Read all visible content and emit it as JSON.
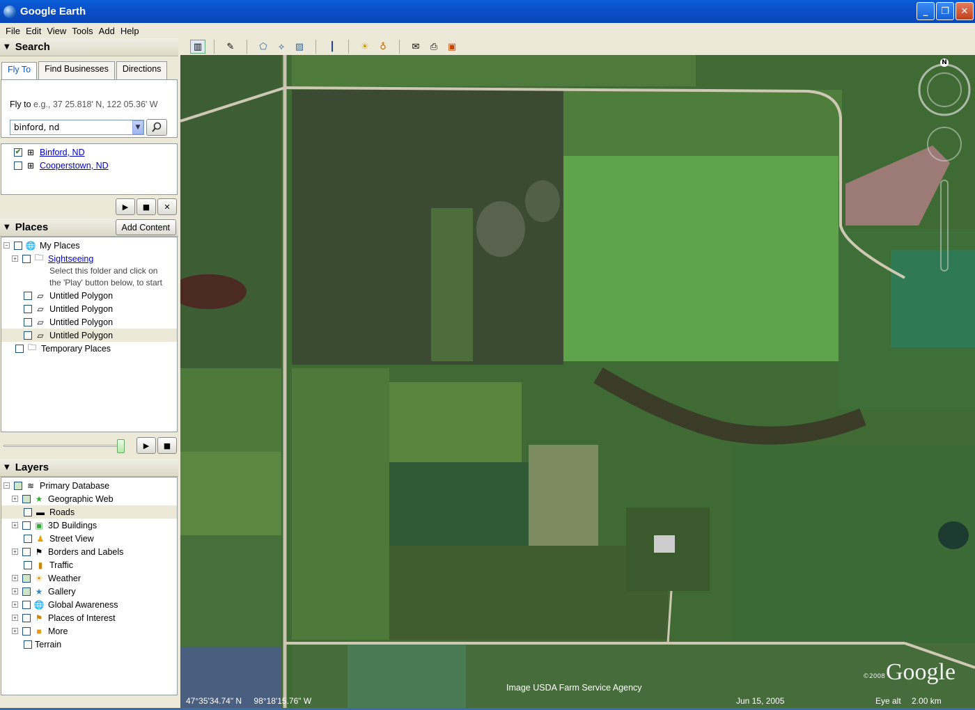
{
  "window": {
    "title": "Google Earth"
  },
  "menu": [
    "File",
    "Edit",
    "View",
    "Tools",
    "Add",
    "Help"
  ],
  "search": {
    "header": "Search",
    "tabs": [
      "Fly To",
      "Find Businesses",
      "Directions"
    ],
    "fly_label": "Fly to",
    "fly_hint": "e.g., 37 25.818' N, 122 05.36' W",
    "query": "binford, nd",
    "results": [
      {
        "label": "Binford, ND",
        "checked": true
      },
      {
        "label": "Cooperstown, ND",
        "checked": false
      }
    ]
  },
  "places": {
    "header": "Places",
    "add_content": "Add Content",
    "my_places": "My Places",
    "sightseeing": "Sightseeing",
    "note_line1": "Select this folder and click on",
    "note_line2": "the 'Play' button below, to start",
    "polygons": [
      "Untitled Polygon",
      "Untitled Polygon",
      "Untitled Polygon",
      "Untitled Polygon"
    ],
    "temporary": "Temporary Places"
  },
  "layers": {
    "header": "Layers",
    "root": "Primary Database",
    "items": [
      "Geographic Web",
      "Roads",
      "3D Buildings",
      "Street View",
      "Borders and Labels",
      "Traffic",
      "Weather",
      "Gallery",
      "Global Awareness",
      "Places of Interest",
      "More"
    ],
    "terrain": "Terrain"
  },
  "map": {
    "credit": "Image USDA Farm Service Agency",
    "lat": "47°35'34.74\" N",
    "lon": "98°18'15.76\" W",
    "date": "Jun 15, 2005",
    "eye_alt_label": "Eye alt",
    "eye_alt_value": "2.00 km",
    "logo": "Google",
    "copyright": "©2008",
    "compass_n": "N"
  },
  "colors": {
    "titlebar": "#0a5fd8",
    "panel": "#ece9d8",
    "link": "#0000cc"
  }
}
